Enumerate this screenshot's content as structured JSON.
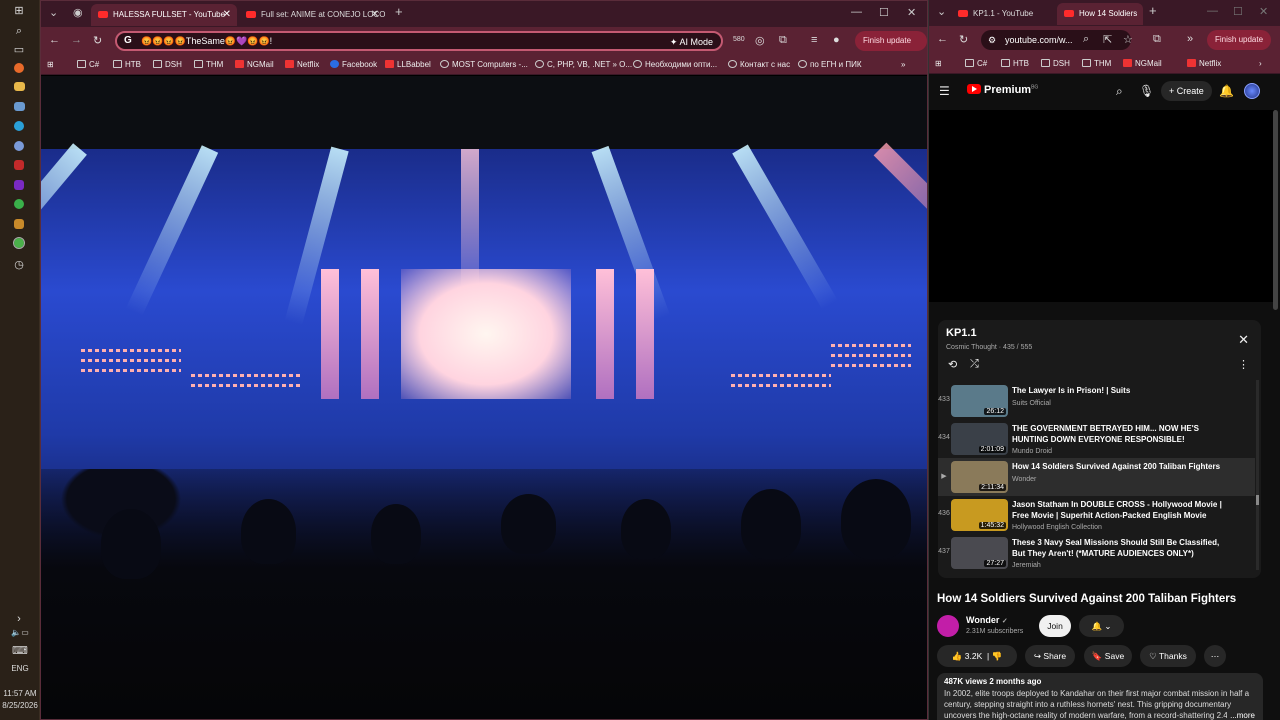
{
  "taskbar": {
    "language": "ENG",
    "time": "11:57 AM",
    "date": "8/25/2026"
  },
  "left_window": {
    "tabs": [
      {
        "label": "HALESSA FULLSET - YouTube"
      },
      {
        "label": "Full set: ANIME at CONEJO LOCO"
      }
    ],
    "address": "😡😡😡😡TheSame😡💜😡😡!",
    "ai_mode": "AI Mode",
    "badge": "580",
    "finish_update": "Finish update",
    "bookmarks": [
      {
        "label": "C#",
        "icon": "folder-icon"
      },
      {
        "label": "НТВ",
        "icon": "folder-icon"
      },
      {
        "label": "DSH",
        "icon": "folder-icon"
      },
      {
        "label": "THM",
        "icon": "folder-icon"
      },
      {
        "label": "NGMail",
        "icon": "gmail-icon"
      },
      {
        "label": "Netflix",
        "icon": "netflix-icon"
      },
      {
        "label": "Facebook",
        "icon": "facebook-icon"
      },
      {
        "label": "LLBabbel",
        "icon": "babbel-icon"
      },
      {
        "label": "MOST Computers -...",
        "icon": "globe-icon"
      },
      {
        "label": "C, PHP, VB, .NET » O...",
        "icon": "globe-icon"
      },
      {
        "label": "Необходими опти...",
        "icon": "globe-icon"
      },
      {
        "label": "Контакт с нас",
        "icon": "globe-icon"
      },
      {
        "label": "по ЕГН и ПИК",
        "icon": "globe-icon"
      }
    ]
  },
  "right_window": {
    "tabs": [
      {
        "label": "KP1.1 - YouTube"
      },
      {
        "label": "How 14 Soldiers"
      }
    ],
    "url": "youtube.com/w...",
    "finish_update": "Finish update",
    "bookmarks": [
      {
        "label": "C#"
      },
      {
        "label": "НТВ"
      },
      {
        "label": "DSH"
      },
      {
        "label": "THM"
      },
      {
        "label": "NGMail"
      },
      {
        "label": "Netflix"
      }
    ],
    "youtube": {
      "logo": "Premium",
      "region": "BG",
      "create_label": "Create",
      "playlist": {
        "title": "KP1.1",
        "subtitle": "Cosmic Thought · 435 / 555",
        "items": [
          {
            "num": "433",
            "title": "The Lawyer Is in Prison! | Suits",
            "channel": "Suits Official",
            "duration": "26:12",
            "thumb": "#5a7a8a"
          },
          {
            "num": "434",
            "title": "THE GOVERNMENT BETRAYED HIM... NOW HE'S HUNTING DOWN EVERYONE RESPONSIBLE!",
            "channel": "Mundo Droid",
            "duration": "2:01:09",
            "thumb": "#3a4048"
          },
          {
            "num": "▶",
            "title": "How 14 Soldiers Survived Against 200 Taliban Fighters",
            "channel": "Wonder",
            "duration": "2:11:34",
            "thumb": "#8a7a5a"
          },
          {
            "num": "436",
            "title": "Jason Statham In DOUBLE CROSS - Hollywood Movie | Free Movie | Superhit Action-Packed English Movie",
            "channel": "Hollywood English Collection",
            "duration": "1:45:32",
            "thumb": "#c89a20"
          },
          {
            "num": "437",
            "title": "These 3 Navy Seal Missions Should Still Be Classified, But They Aren't! (*MATURE AUDIENCES ONLY*)",
            "channel": "Jeremiah",
            "duration": "27:27",
            "thumb": "#4a4a50"
          }
        ]
      },
      "video_title": "How 14 Soldiers Survived Against 200 Taliban Fighters",
      "channel_name": "Wonder",
      "subscribers": "2.31M subscribers",
      "join_label": "Join",
      "likes": "3.2K",
      "share_label": "Share",
      "save_label": "Save",
      "thanks_label": "Thanks",
      "views_meta": "487K views  2 months ago",
      "description": "In 2002, elite troops deployed to Kandahar on their first major combat mission in half a century, stepping straight into a ruthless hornets' nest. This gripping documentary uncovers the high-octane reality of modern warfare, from a record-shattering 2.4...",
      "more_label": "...more"
    }
  },
  "colors": {
    "tab_strip": "#3a1826",
    "toolbar": "#5a2233",
    "youtube_red": "#ff0000",
    "youtube_bg": "#0f0f0f"
  }
}
